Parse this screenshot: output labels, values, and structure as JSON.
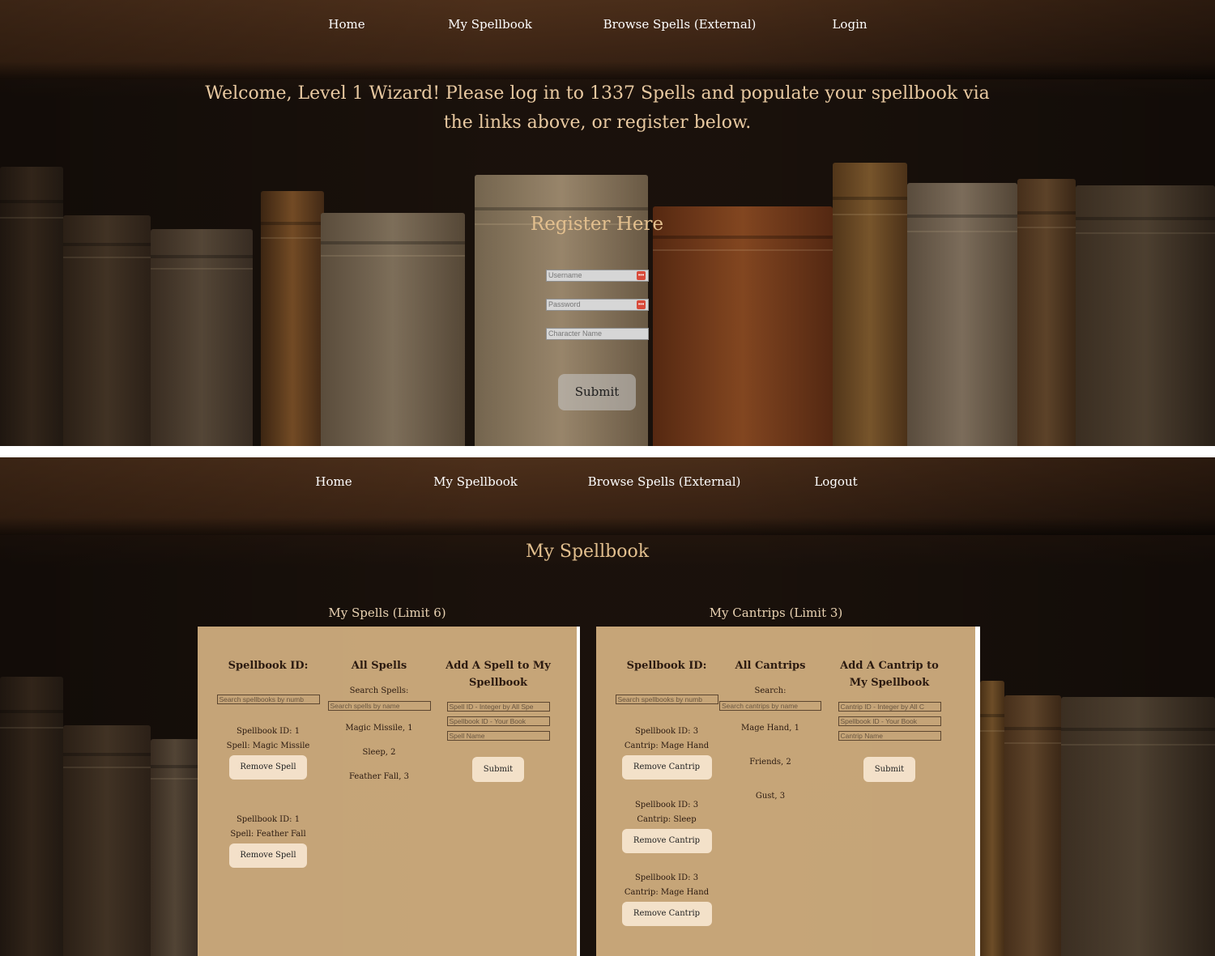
{
  "top": {
    "nav": [
      "Home",
      "My Spellbook",
      "Browse Spells (External)",
      "Login"
    ],
    "welcome": "Welcome, Level 1 Wizard! Please log in to 1337 Spells and populate your spellbook via the links above, or register below.",
    "register_title": "Register Here",
    "placeholders": {
      "username": "Username",
      "password": "Password",
      "character": "Character Name"
    },
    "submit": "Submit"
  },
  "bottom": {
    "nav": [
      "Home",
      "My Spellbook",
      "Browse Spells (External)",
      "Logout"
    ],
    "title": "My Spellbook",
    "spells_card": {
      "title": "My Spells (Limit 6)",
      "col1": "Spellbook ID:",
      "col2": "All Spells",
      "col3": "Add A Spell to My Spellbook",
      "search_label": "Search Spells:",
      "book_search_placeholder": "Search spellbooks by numb",
      "spell_search_placeholder": "Search spells by name",
      "entries": [
        {
          "id": "Spellbook ID: 1",
          "name": "Spell: Magic Missile",
          "button": "Remove Spell"
        },
        {
          "id": "Spellbook ID: 1",
          "name": "Spell: Feather Fall",
          "button": "Remove Spell"
        }
      ],
      "all": [
        "Magic Missile, 1",
        "Sleep, 2",
        "Feather Fall, 3"
      ],
      "add_fields": [
        "Spell ID - Integer by All Spe",
        "Spellbook ID - Your Book",
        "Spell Name"
      ],
      "submit": "Submit"
    },
    "cantrips_card": {
      "title": "My Cantrips (Limit 3)",
      "col1": "Spellbook ID:",
      "col2": "All Cantrips",
      "col3": "Add A Cantrip to My Spellbook",
      "search_label": "Search:",
      "book_search_placeholder": "Search spellbooks by numb",
      "cantrip_search_placeholder": "Search cantrips by name",
      "entries": [
        {
          "id": "Spellbook ID: 3",
          "name": "Cantrip: Mage Hand",
          "button": "Remove Cantrip"
        },
        {
          "id": "Spellbook ID: 3",
          "name": "Cantrip: Sleep",
          "button": "Remove Cantrip"
        },
        {
          "id": "Spellbook ID: 3",
          "name": "Cantrip: Mage Hand",
          "button": "Remove Cantrip"
        }
      ],
      "all": [
        "Mage Hand, 1",
        "Friends, 2",
        "Gust, 3"
      ],
      "add_fields": [
        "Cantrip ID - Integer by All C",
        "Spellbook ID - Your Book",
        "Cantrip Name"
      ],
      "submit": "Submit"
    }
  }
}
